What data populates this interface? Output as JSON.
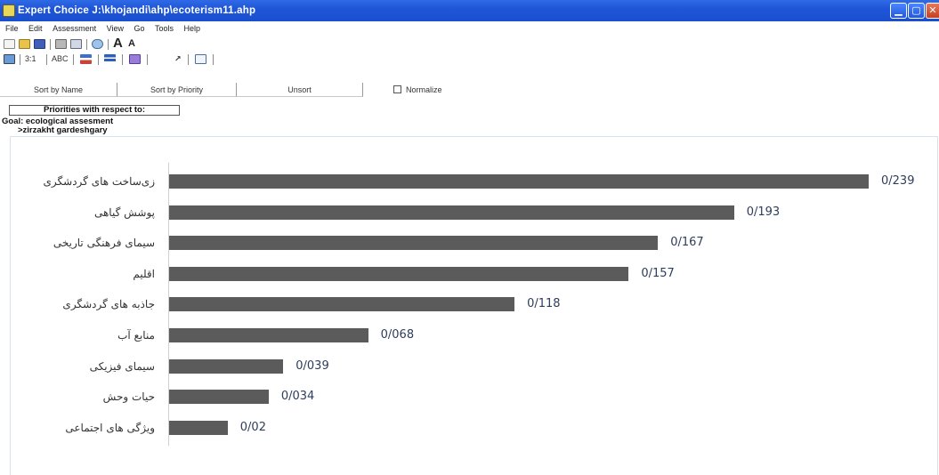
{
  "window": {
    "title": "Expert Choice     J:\\khojandi\\ahp\\ecoterism11.ahp",
    "min_glyph": "▁",
    "max_glyph": "▢",
    "close_glyph": "✕"
  },
  "menu": [
    "File",
    "Edit",
    "Assessment",
    "View",
    "Go",
    "Tools",
    "Help"
  ],
  "toolbar2": {
    "item1": "3:1",
    "item2": "ABC"
  },
  "sort_bar": {
    "sort_by_name": "Sort by Name",
    "sort_by_priority": "Sort by Priority",
    "unsort": "Unsort",
    "normalize": "Normalize"
  },
  "priorities": {
    "header": "Priorities with respect to:",
    "goal": "Goal: ecological assesment",
    "node": ">zirzakht gardeshgary"
  },
  "colors": {
    "bar": "#5b5b5b",
    "value_text": "#2e3d5b",
    "title_bar": "#1f56d8"
  },
  "chart_data": {
    "type": "bar",
    "orientation": "horizontal",
    "grid": false,
    "legend": "none",
    "xlim": [
      0,
      0.239
    ],
    "categories": [
      "زی‌ساخت های گردشگری",
      "پوشش گیاهی",
      "سیمای فرهنگی تاریخی",
      "اقلیم",
      "جاذبه های گردشگری",
      "منابع آب",
      "سیمای فیزیکی",
      "حیات وحش",
      "ویژگی های اجتماعی"
    ],
    "values": [
      0.239,
      0.193,
      0.167,
      0.157,
      0.118,
      0.068,
      0.039,
      0.034,
      0.02
    ],
    "value_labels": [
      "0/239",
      "0/193",
      "0/167",
      "0/157",
      "0/118",
      "0/068",
      "0/039",
      "0/034",
      "0/02"
    ]
  }
}
